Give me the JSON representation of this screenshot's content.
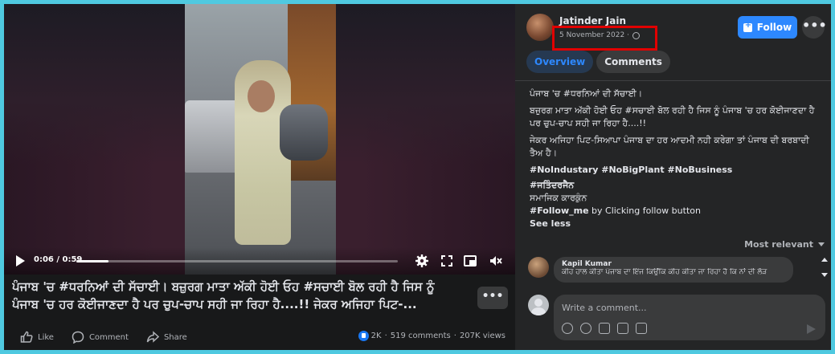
{
  "video": {
    "time": "0:06 / 0:59",
    "progress_fraction": 0.1
  },
  "caption": "ਪੰਜਾਬ 'ਚ #ਧਰਨਿਆਂ ਦੀ ਸੱਚਾਈ। ਬਜ਼ੁਰਗ ਮਾਤਾ ਅੱਕੀ ਹੋਈ ਓਹ #ਸਚਾਈ ਬੋਲ ਰਹੀ ਹੈ ਜਿਸ ਨੂੰ ਪੰਜਾਬ 'ਚ ਹਰ ਕੋਈਜਾਣਦਾ ਹੈ ਪਰ ਚੁਪ-ਚਾਪ ਸਹੀ ਜਾ ਰਿਹਾ ਹੈ....!! ਜੇਕਰ ਅਜਿਹਾ ਪਿਟ-...",
  "more_label": "•••",
  "actions": {
    "like": "Like",
    "comment": "Comment",
    "share": "Share"
  },
  "stats": {
    "reactions": "2K",
    "separator": "·",
    "comments": "519 comments",
    "views": "207K views"
  },
  "post": {
    "author": "Jatinder Jain",
    "date": "5 November 2022",
    "date_sep": "·",
    "follow_label": "Follow",
    "more_label": "•••",
    "tabs": [
      "Overview",
      "Comments"
    ],
    "body": [
      "ਪੰਜਾਬ 'ਚ #ਧਰਨਿਆਂ ਦੀ ਸੱਚਾਈ।",
      "ਬਜ਼ੁਰਗ ਮਾਤਾ ਅੱਕੀ ਹੋਈ ਓਹ #ਸਚਾਈ ਬੋਲ ਰਹੀ ਹੈ ਜਿਸ ਨੂੰ ਪੰਜਾਬ 'ਚ ਹਰ ਕੋਈਜਾਣਦਾ ਹੈ ਪਰ ਚੁਪ-ਚਾਪ ਸਹੀ ਜਾ ਰਿਹਾ ਹੈ....!!",
      "ਜੇਕਰ ਅਜਿਹਾ ਪਿਟ-ਸਿਆਪਾ ਪੰਜਾਬ ਦਾ ਹਰ ਆਦਮੀ ਨਹੀ ਕਰੇਗਾ ਤਾਂ ਪੰਜਾਬ ਦੀ ਬਰਬਾਦੀ ਤੈਅ ਹੈ।"
    ],
    "hashtags": "#NoIndustary #NoBigPlant #NoBusiness",
    "hashtag_name": "#ਜਤਿੰਦਰਜੈਨ",
    "role": "ਸਮਾਜਿਕ ਕਾਰਕੁੰਨ",
    "follow_me_tag": "#Follow_me",
    "follow_me_text": " by Clicking follow button",
    "see_less": "See less"
  },
  "comments": {
    "sort_label": "Most relevant",
    "first": {
      "name": "Kapil Kumar",
      "text": "ਕੀਹ ਹਾਲ ਕੀਤਾ ਪੰਜਾਬ ਦਾ ਇੰਜ ਕਿਉਂਕਿ ਕੀਹ ਕੀਤਾ ਜਾ ਰਿਹਾ ਹੈ ਕਿ ਨਾਂ ਦੀ ਲੋੜ"
    },
    "composer_placeholder": "Write a comment..."
  },
  "colors": {
    "accent": "#2d88ff",
    "highlight_box": "#e10000",
    "page_bg": "#4fc9e0"
  }
}
